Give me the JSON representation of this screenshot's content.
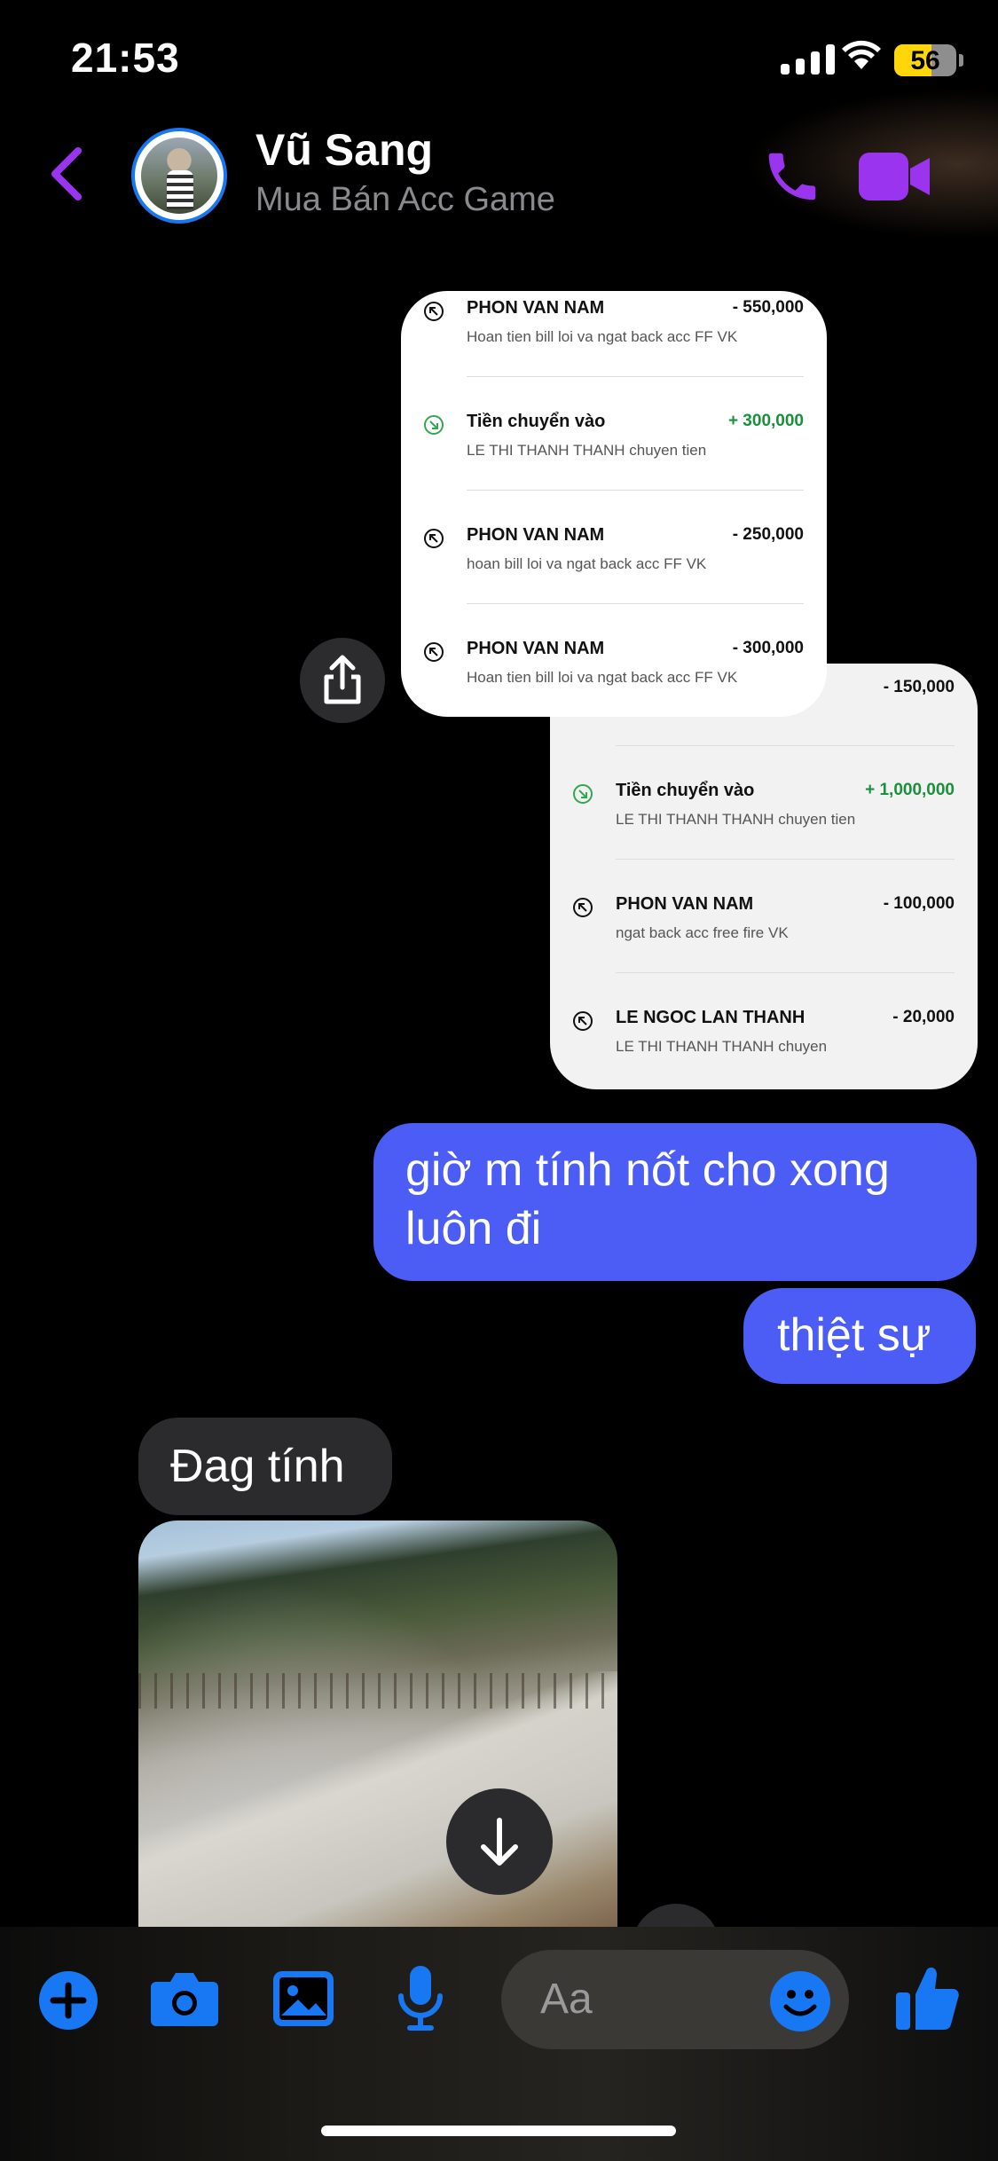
{
  "status_bar": {
    "time": "21:53",
    "battery": "56"
  },
  "header": {
    "name": "Vũ Sang",
    "subtitle": "Mua Bán Acc Game",
    "accent_color": "#9b34ef"
  },
  "image_card_1": {
    "transactions": [
      {
        "title": "PHON VAN NAM",
        "amount": "- 550,000",
        "desc": "Hoan tien bill loi va ngat back acc FF VK",
        "type": "out"
      },
      {
        "title": "Tiền chuyển vào",
        "amount": "+ 300,000",
        "desc": "LE THI THANH THANH chuyen tien",
        "type": "in"
      },
      {
        "title": "PHON VAN NAM",
        "amount": "- 250,000",
        "desc": "hoan bill loi va ngat back acc FF VK",
        "type": "out"
      },
      {
        "title": "PHON VAN NAM",
        "amount": "- 300,000",
        "desc": "Hoan tien bill loi va ngat back acc FF VK",
        "type": "out"
      }
    ]
  },
  "image_card_2": {
    "top_amount": "- 150,000",
    "transactions": [
      {
        "title": "Tiền chuyển vào",
        "amount": "+ 1,000,000",
        "desc": "LE THI THANH THANH chuyen tien",
        "type": "in"
      },
      {
        "title": "PHON VAN NAM",
        "amount": "- 100,000",
        "desc": "ngat back acc free fire VK",
        "type": "out"
      },
      {
        "title": "LE NGOC LAN THANH",
        "amount": "- 20,000",
        "desc": "LE THI THANH THANH chuyen",
        "type": "out"
      }
    ]
  },
  "messages": {
    "outgoing_1": "giờ m tính nốt cho xong luôn đi",
    "outgoing_2": "thiệt sự",
    "incoming_1": "Đag tính"
  },
  "composer": {
    "placeholder": "Aa"
  },
  "colors": {
    "outgoing_bubble": "#4b5df5",
    "incoming_bubble": "#2b2b2d",
    "messenger_blue": "#1877f2"
  }
}
